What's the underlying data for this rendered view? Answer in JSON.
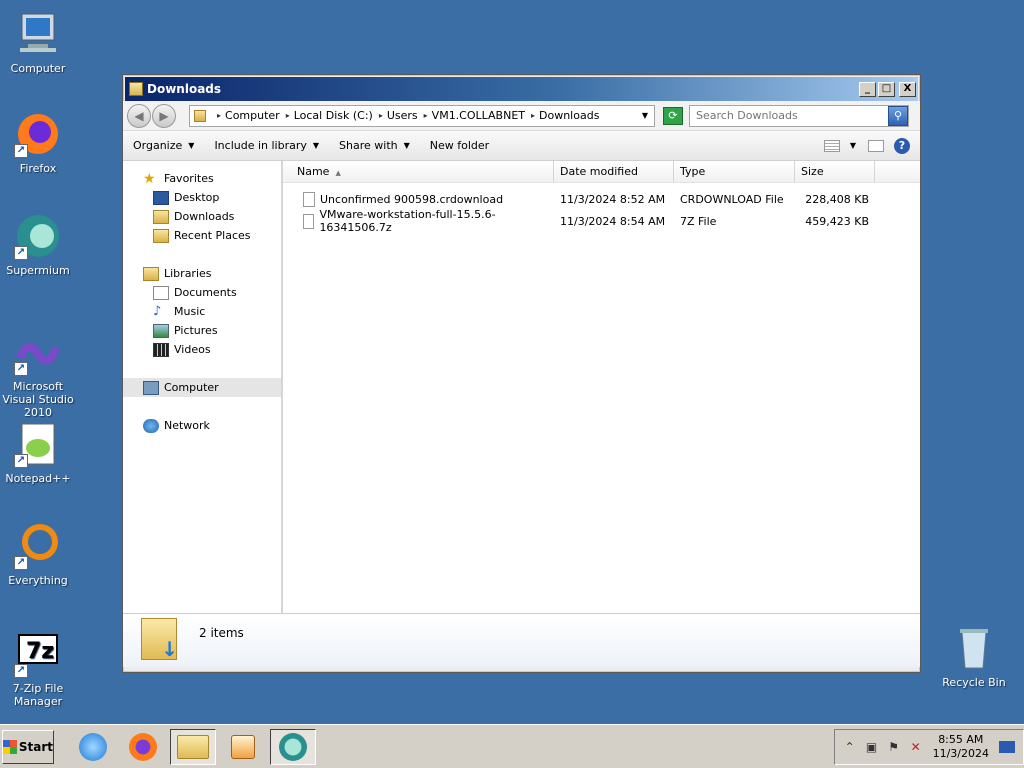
{
  "desktop": {
    "icons": [
      {
        "label": "Computer"
      },
      {
        "label": "Firefox"
      },
      {
        "label": "Supermium"
      },
      {
        "label": "Microsoft Visual Studio 2010"
      },
      {
        "label": "Notepad++"
      },
      {
        "label": "Everything"
      },
      {
        "label": "7-Zip File Manager"
      },
      {
        "label": "Recycle Bin"
      }
    ]
  },
  "window": {
    "title": "Downloads",
    "controls": {
      "minimize": "_",
      "maximize": "□",
      "close": "X"
    },
    "address": {
      "crumbs": [
        "Computer",
        "Local Disk (C:)",
        "Users",
        "VM1.COLLABNET",
        "Downloads"
      ]
    },
    "search": {
      "placeholder": "Search Downloads"
    },
    "toolbar": {
      "organize": "Organize",
      "include_in_library": "Include in library",
      "share_with": "Share with",
      "new_folder": "New folder"
    },
    "nav": {
      "favorites": "Favorites",
      "desktop": "Desktop",
      "downloads": "Downloads",
      "recent_places": "Recent Places",
      "libraries": "Libraries",
      "documents": "Documents",
      "music": "Music",
      "pictures": "Pictures",
      "videos": "Videos",
      "computer": "Computer",
      "network": "Network"
    },
    "columns": {
      "name": "Name",
      "date": "Date modified",
      "type": "Type",
      "size": "Size"
    },
    "files": [
      {
        "name": "Unconfirmed 900598.crdownload",
        "date": "11/3/2024 8:52 AM",
        "type": "CRDOWNLOAD File",
        "size": "228,408 KB"
      },
      {
        "name": "VMware-workstation-full-15.5.6-16341506.7z",
        "date": "11/3/2024 8:54 AM",
        "type": "7Z File",
        "size": "459,423 KB"
      }
    ],
    "details": {
      "count": "2 items"
    }
  },
  "taskbar": {
    "start": "Start",
    "clock": {
      "time": "8:55 AM",
      "date": "11/3/2024"
    }
  }
}
